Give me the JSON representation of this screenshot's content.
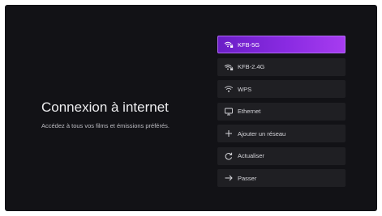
{
  "page": {
    "title": "Connexion à internet",
    "subtitle": "Accédez à tous vos films et émissions préférés."
  },
  "options": [
    {
      "label": "KFB-5G",
      "icon": "wifi-lock-icon",
      "selected": true
    },
    {
      "label": "KFB-2.4G",
      "icon": "wifi-lock-icon",
      "selected": false
    },
    {
      "label": "WPS",
      "icon": "wifi-icon",
      "selected": false
    },
    {
      "label": "Ethernet",
      "icon": "ethernet-icon",
      "selected": false
    },
    {
      "label": "Ajouter un réseau",
      "icon": "plus-icon",
      "selected": false
    },
    {
      "label": "Actualiser",
      "icon": "refresh-icon",
      "selected": false
    },
    {
      "label": "Passer",
      "icon": "arrow-right-icon",
      "selected": false
    }
  ],
  "colors": {
    "background": "#121216",
    "option_background": "#1f1f23",
    "selected_gradient_start": "#6a1ec6",
    "selected_gradient_end": "#a73cf0",
    "text": "#ececee"
  }
}
